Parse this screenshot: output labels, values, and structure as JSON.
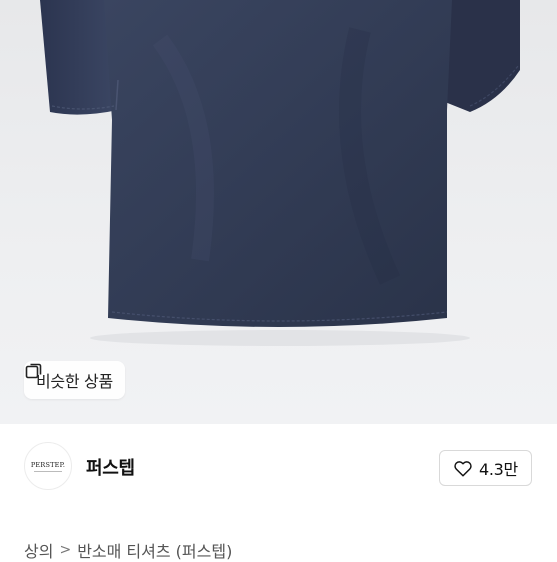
{
  "product": {
    "image_alt_icon": "navy-tshirt-photo",
    "similar_button_label": "비슷한 상품",
    "similar_icon": "copy-square-icon"
  },
  "brand": {
    "logo_text": "PERSTEP.",
    "name": "퍼스텝",
    "likes": "4.3만",
    "like_icon": "heart-outline-icon"
  },
  "breadcrumb": {
    "items": [
      "상의",
      "반소매 티셔츠 (퍼스텝)"
    ],
    "separator": ">"
  },
  "colors": {
    "shirt": "#333d57",
    "background": "#eeeff1",
    "text": "#111111"
  }
}
